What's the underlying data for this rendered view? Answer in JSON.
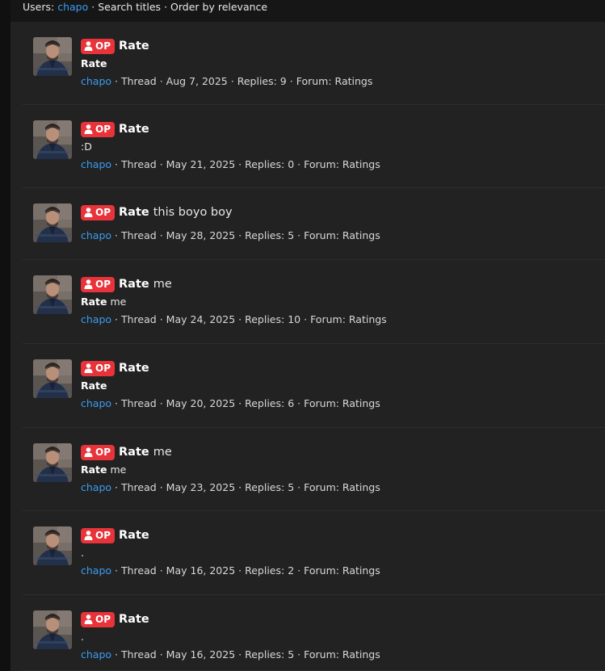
{
  "filter_bar": {
    "users_label": "Users:",
    "user": "chapo",
    "search_titles": "Search titles",
    "order": "Order by relevance",
    "sep": "·"
  },
  "badge_label": "OP",
  "results": [
    {
      "title_bold": "Rate",
      "title_rest": "",
      "snippet_bold": "Rate",
      "snippet_rest": "",
      "author": "chapo",
      "type": "Thread",
      "date": "Aug 7, 2025",
      "replies": "Replies: 9",
      "forum": "Forum: Ratings"
    },
    {
      "title_bold": "Rate",
      "title_rest": "",
      "snippet_bold": "",
      "snippet_rest": ":D",
      "author": "chapo",
      "type": "Thread",
      "date": "May 21, 2025",
      "replies": "Replies: 0",
      "forum": "Forum: Ratings"
    },
    {
      "title_bold": "Rate",
      "title_rest": "this boyo boy",
      "snippet_bold": "",
      "snippet_rest": "",
      "author": "chapo",
      "type": "Thread",
      "date": "May 28, 2025",
      "replies": "Replies: 5",
      "forum": "Forum: Ratings"
    },
    {
      "title_bold": "Rate",
      "title_rest": "me",
      "snippet_bold": "Rate",
      "snippet_rest": "me",
      "author": "chapo",
      "type": "Thread",
      "date": "May 24, 2025",
      "replies": "Replies: 10",
      "forum": "Forum: Ratings"
    },
    {
      "title_bold": "Rate",
      "title_rest": "",
      "snippet_bold": "Rate",
      "snippet_rest": "",
      "author": "chapo",
      "type": "Thread",
      "date": "May 20, 2025",
      "replies": "Replies: 6",
      "forum": "Forum: Ratings"
    },
    {
      "title_bold": "Rate",
      "title_rest": "me",
      "snippet_bold": "Rate",
      "snippet_rest": "me",
      "author": "chapo",
      "type": "Thread",
      "date": "May 23, 2025",
      "replies": "Replies: 5",
      "forum": "Forum: Ratings"
    },
    {
      "title_bold": "Rate",
      "title_rest": "",
      "snippet_bold": "",
      "snippet_rest": ".",
      "author": "chapo",
      "type": "Thread",
      "date": "May 16, 2025",
      "replies": "Replies: 2",
      "forum": "Forum: Ratings"
    },
    {
      "title_bold": "Rate",
      "title_rest": "",
      "snippet_bold": "",
      "snippet_rest": ".",
      "author": "chapo",
      "type": "Thread",
      "date": "May 16, 2025",
      "replies": "Replies: 5",
      "forum": "Forum: Ratings"
    }
  ]
}
